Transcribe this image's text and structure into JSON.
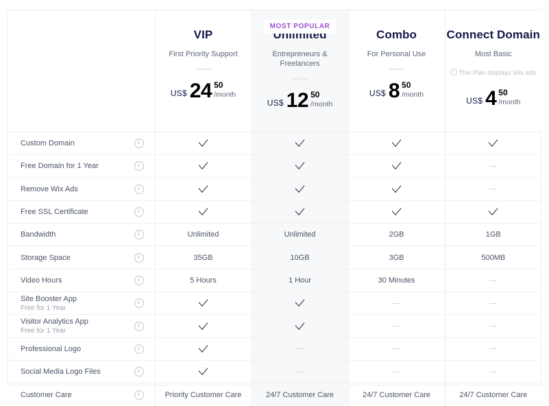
{
  "badge": {
    "label": "MOST POPULAR"
  },
  "plans": [
    {
      "name": "VIP",
      "desc": "First Priority Support",
      "note": null,
      "currency": "US$",
      "amount": "24",
      "cents": "50",
      "period": "/month",
      "highlight": false,
      "popular": false
    },
    {
      "name": "Unlimited",
      "desc": "Entrepreneurs & Freelancers",
      "note": null,
      "currency": "US$",
      "amount": "12",
      "cents": "50",
      "period": "/month",
      "highlight": true,
      "popular": true
    },
    {
      "name": "Combo",
      "desc": "For Personal Use",
      "note": null,
      "currency": "US$",
      "amount": "8",
      "cents": "50",
      "period": "/month",
      "highlight": false,
      "popular": false
    },
    {
      "name": "Connect Domain",
      "desc": "Most Basic",
      "note": "This Plan displays Wix ads",
      "currency": "US$",
      "amount": "4",
      "cents": "50",
      "period": "/month",
      "highlight": false,
      "popular": false
    }
  ],
  "features": [
    {
      "label": "Custom Domain",
      "sub": null,
      "values": [
        "check",
        "check",
        "check",
        "check"
      ]
    },
    {
      "label": "Free Domain for 1 Year",
      "sub": null,
      "values": [
        "check",
        "check",
        "check",
        "dash"
      ]
    },
    {
      "label": "Remove Wix Ads",
      "sub": null,
      "values": [
        "check",
        "check",
        "check",
        "dash"
      ]
    },
    {
      "label": "Free SSL Certificate",
      "sub": null,
      "values": [
        "check",
        "check",
        "check",
        "check"
      ]
    },
    {
      "label": "Bandwidth",
      "sub": null,
      "values": [
        "Unlimited",
        "Unlimited",
        "2GB",
        "1GB"
      ]
    },
    {
      "label": "Storage Space",
      "sub": null,
      "values": [
        "35GB",
        "10GB",
        "3GB",
        "500MB"
      ]
    },
    {
      "label": "Video Hours",
      "sub": null,
      "values": [
        "5 Hours",
        "1 Hour",
        "30 Minutes",
        "dash"
      ]
    },
    {
      "label": "Site Booster App",
      "sub": "Free for 1 Year",
      "values": [
        "check",
        "check",
        "dash",
        "dash"
      ]
    },
    {
      "label": "Visitor Analytics App",
      "sub": "Free for 1 Year",
      "values": [
        "check",
        "check",
        "dash",
        "dash"
      ]
    },
    {
      "label": "Professional Logo",
      "sub": null,
      "values": [
        "check",
        "dash",
        "dash",
        "dash"
      ]
    },
    {
      "label": "Social Media Logo Files",
      "sub": null,
      "values": [
        "check",
        "dash",
        "dash",
        "dash"
      ]
    },
    {
      "label": "Customer Care",
      "sub": null,
      "values": [
        "Priority Customer Care",
        "24/7 Customer Care",
        "24/7 Customer Care",
        "24/7 Customer Care"
      ]
    }
  ],
  "colors": {
    "badge_purple": "#9f4fd1",
    "plan_name": "#13194a",
    "body_text": "#4a5366",
    "muted_text": "#9aa1ad",
    "highlight_bg": "#f7f8f9",
    "border": "#eceef0"
  }
}
